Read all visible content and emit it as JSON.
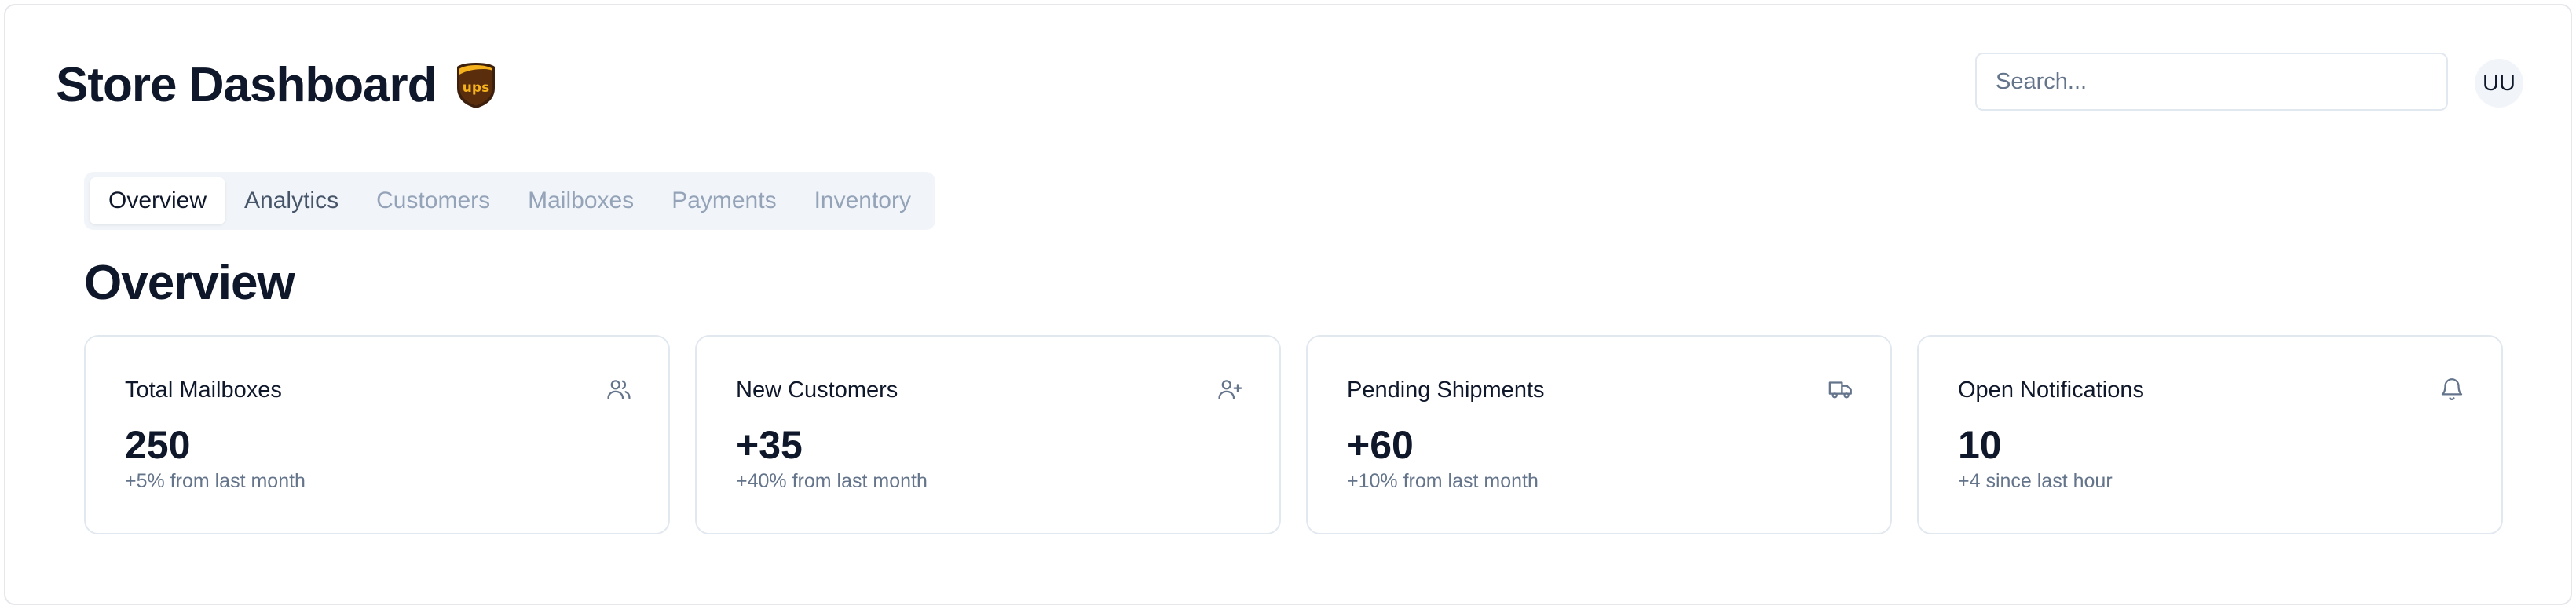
{
  "header": {
    "title": "Store Dashboard",
    "logo_icon": "ups-shield-logo",
    "search_placeholder": "Search...",
    "avatar_initials": "UU"
  },
  "tabs": [
    {
      "label": "Overview",
      "state": "active"
    },
    {
      "label": "Analytics",
      "state": "enabled"
    },
    {
      "label": "Customers",
      "state": "disabled"
    },
    {
      "label": "Mailboxes",
      "state": "disabled"
    },
    {
      "label": "Payments",
      "state": "disabled"
    },
    {
      "label": "Inventory",
      "state": "disabled"
    }
  ],
  "section_title": "Overview",
  "cards": [
    {
      "title": "Total Mailboxes",
      "value": "250",
      "sub": "+5% from last month",
      "icon": "users-icon"
    },
    {
      "title": "New Customers",
      "value": "+35",
      "sub": "+40% from last month",
      "icon": "user-plus-icon"
    },
    {
      "title": "Pending Shipments",
      "value": "+60",
      "sub": "+10% from last month",
      "icon": "truck-icon"
    },
    {
      "title": "Open Notifications",
      "value": "10",
      "sub": "+4 since last hour",
      "icon": "bell-icon"
    }
  ],
  "colors": {
    "text": "#0f172a",
    "muted": "#64748b",
    "tab_bg": "#f1f5f9",
    "border": "#e2e8f0",
    "ups_brown": "#3d1f0d",
    "ups_gold": "#f5b21c"
  }
}
